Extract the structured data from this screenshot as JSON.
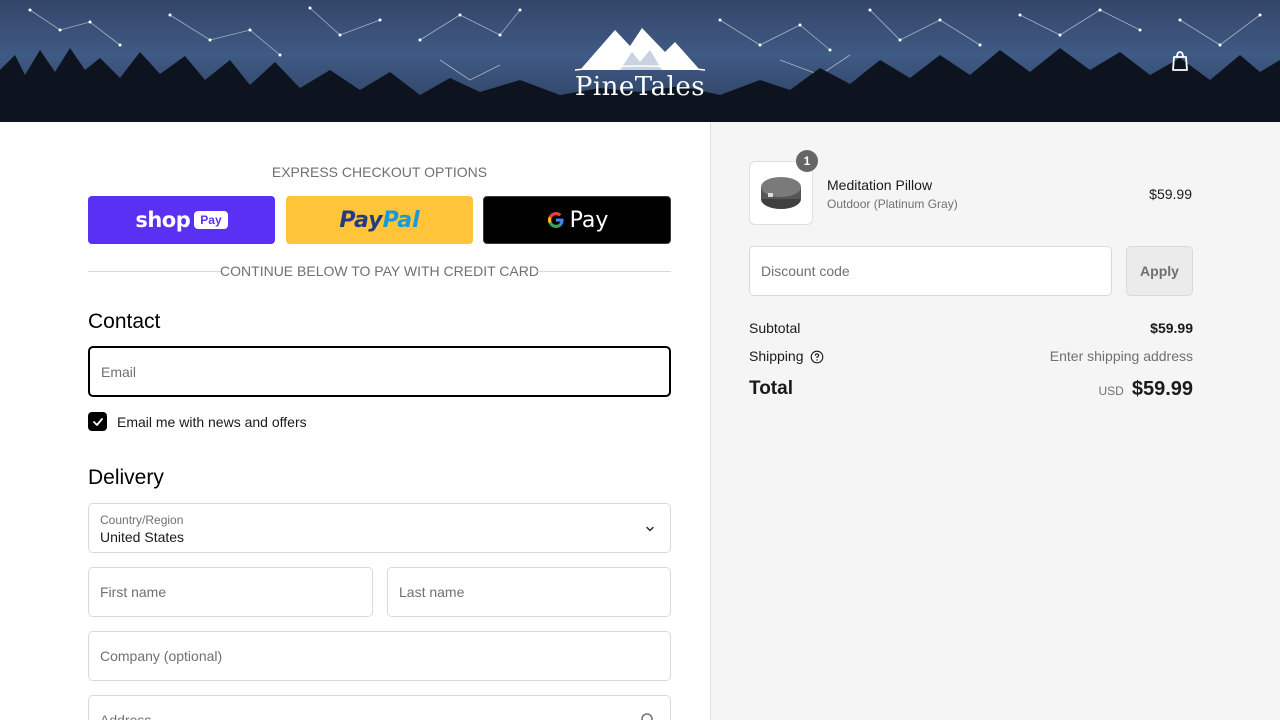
{
  "header": {
    "brand": "PineTales",
    "cart_icon": "shopping-bag-icon"
  },
  "express": {
    "title": "EXPRESS CHECKOUT OPTIONS",
    "shop_pay": {
      "word": "shop",
      "badge": "Pay"
    },
    "paypal": {
      "part1": "Pay",
      "part2": "Pal"
    },
    "gpay": {
      "word": "Pay"
    },
    "divider_text": "CONTINUE BELOW TO PAY WITH CREDIT CARD"
  },
  "contact": {
    "title": "Contact",
    "email_placeholder": "Email",
    "email_value": "",
    "newsletter_label": "Email me with news and offers",
    "newsletter_checked": true
  },
  "delivery": {
    "title": "Delivery",
    "country_label": "Country/Region",
    "country_value": "United States",
    "first_name_placeholder": "First name",
    "last_name_placeholder": "Last name",
    "company_placeholder": "Company (optional)",
    "address_placeholder": "Address"
  },
  "order": {
    "quantity": "1",
    "product_name": "Meditation Pillow",
    "product_variant": "Outdoor (Platinum Gray)",
    "product_price": "$59.99",
    "discount_placeholder": "Discount code",
    "apply_label": "Apply",
    "subtotal_label": "Subtotal",
    "subtotal_value": "$59.99",
    "shipping_label": "Shipping",
    "shipping_value": "Enter shipping address",
    "total_label": "Total",
    "total_currency": "USD",
    "total_value": "$59.99"
  },
  "colors": {
    "shop_pay": "#5a31f4",
    "paypal": "#ffc439",
    "gpay": "#000000"
  }
}
